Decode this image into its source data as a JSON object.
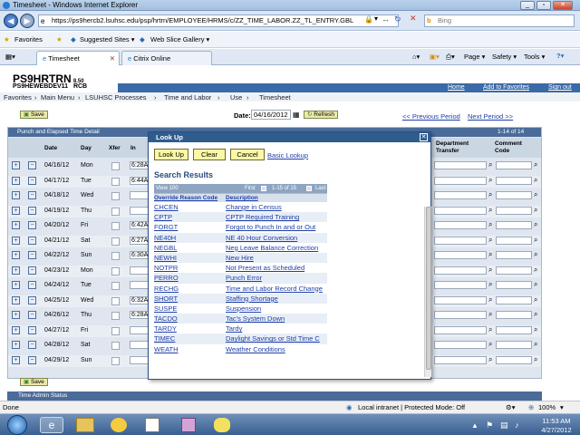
{
  "window": {
    "title": "Timesheet - Windows Internet Explorer"
  },
  "address": {
    "url": "https://ps9hercb2.lsuhsc.edu/psp/hrtrn/EMPLOYEE/HRMS/c/ZZ_TIME_LABOR.ZZ_TL_ENTRY.GBL",
    "search_placeholder": "Bing"
  },
  "favbar": {
    "favorites": "Favorites",
    "suggested": "Suggested Sites ▾",
    "webslice": "Web Slice Gallery ▾"
  },
  "tabs": [
    {
      "label": "Timesheet"
    },
    {
      "label": "Citrix Online"
    }
  ],
  "toolbar": {
    "page": "Page ▾",
    "safety": "Safety ▾",
    "tools": "Tools ▾"
  },
  "ps": {
    "title": "PS9HRTRN",
    "version": "8.50",
    "db": "PS9HEWEBDEV11",
    "sub": "RCB",
    "home": "Home",
    "add_fav": "Add to Favorites",
    "signout": "Sign out"
  },
  "breadcrumbs": [
    "Favorites",
    "Main Menu",
    "LSUHSC Processes",
    "Time and Labor",
    "Use",
    "Timesheet"
  ],
  "page": {
    "save": "Save",
    "date_label": "Date:",
    "date_value": "04/16/2012",
    "refresh": "Refresh",
    "prev": "<< Previous Period",
    "next": "Next Period >>"
  },
  "grid": {
    "title": "Punch and Elapsed Time Detail",
    "count": "1-14 of 14",
    "col_date": "Date",
    "col_day": "Day",
    "col_xfer": "Xfer",
    "col_in": "In",
    "col_dept": "Department Transfer",
    "col_comment": "Comment Code",
    "rows": [
      {
        "date": "04/16/12",
        "day": "Mon",
        "in": "6:28A"
      },
      {
        "date": "04/17/12",
        "day": "Tue",
        "in": "6:44A"
      },
      {
        "date": "04/18/12",
        "day": "Wed",
        "in": ""
      },
      {
        "date": "04/19/12",
        "day": "Thu",
        "in": ""
      },
      {
        "date": "04/20/12",
        "day": "Fri",
        "in": "6:42A"
      },
      {
        "date": "04/21/12",
        "day": "Sat",
        "in": "6:27A"
      },
      {
        "date": "04/22/12",
        "day": "Sun",
        "in": "6:30A"
      },
      {
        "date": "04/23/12",
        "day": "Mon",
        "in": ""
      },
      {
        "date": "04/24/12",
        "day": "Tue",
        "in": ""
      },
      {
        "date": "04/25/12",
        "day": "Wed",
        "in": "6:32A"
      },
      {
        "date": "04/26/12",
        "day": "Thu",
        "in": "6:28A"
      },
      {
        "date": "04/27/12",
        "day": "Fri",
        "in": ""
      },
      {
        "date": "04/28/12",
        "day": "Sat",
        "in": ""
      },
      {
        "date": "04/29/12",
        "day": "Sun",
        "in": ""
      }
    ],
    "save_bottom": "Save",
    "next_section": "Time Admin Status"
  },
  "modal": {
    "title": "Look Up",
    "lookup_btn": "Look Up",
    "clear_btn": "Clear",
    "cancel_btn": "Cancel",
    "basic_link": "Basic Lookup",
    "results_title": "Search Results",
    "view": "View 100",
    "first": "First",
    "range": "1-15 of 15",
    "last": "Last",
    "col_code": "Override Reason Code",
    "col_desc": "Description",
    "rows": [
      {
        "code": "CHCEN",
        "desc": "Change in Census"
      },
      {
        "code": "CPTP",
        "desc": "CPTP Required Training"
      },
      {
        "code": "FORGT",
        "desc": "Forgot to Punch In and or Out"
      },
      {
        "code": "NE40H",
        "desc": "NE 40 Hour Conversion"
      },
      {
        "code": "NEGBL",
        "desc": "Neg Leave Balance Correction"
      },
      {
        "code": "NEWHI",
        "desc": "New Hire"
      },
      {
        "code": "NOTPR",
        "desc": "Not Present as Scheduled"
      },
      {
        "code": "PERRO",
        "desc": "Punch Error"
      },
      {
        "code": "RECHG",
        "desc": "Time and Labor Record Change"
      },
      {
        "code": "SHORT",
        "desc": "Staffing Shortage"
      },
      {
        "code": "SUSPE",
        "desc": "Suspension"
      },
      {
        "code": "TACDO",
        "desc": "Tac's System Down"
      },
      {
        "code": "TARDY",
        "desc": "Tardy"
      },
      {
        "code": "TIMEC",
        "desc": "Daylight Savings or Std Time C"
      },
      {
        "code": "WEATH",
        "desc": "Weather Conditions"
      }
    ]
  },
  "status": {
    "left": "Done",
    "zone": "Local intranet | Protected Mode: Off",
    "zoom": "100%"
  },
  "clock": {
    "time": "11:53 AM",
    "date": "4/27/2012"
  }
}
